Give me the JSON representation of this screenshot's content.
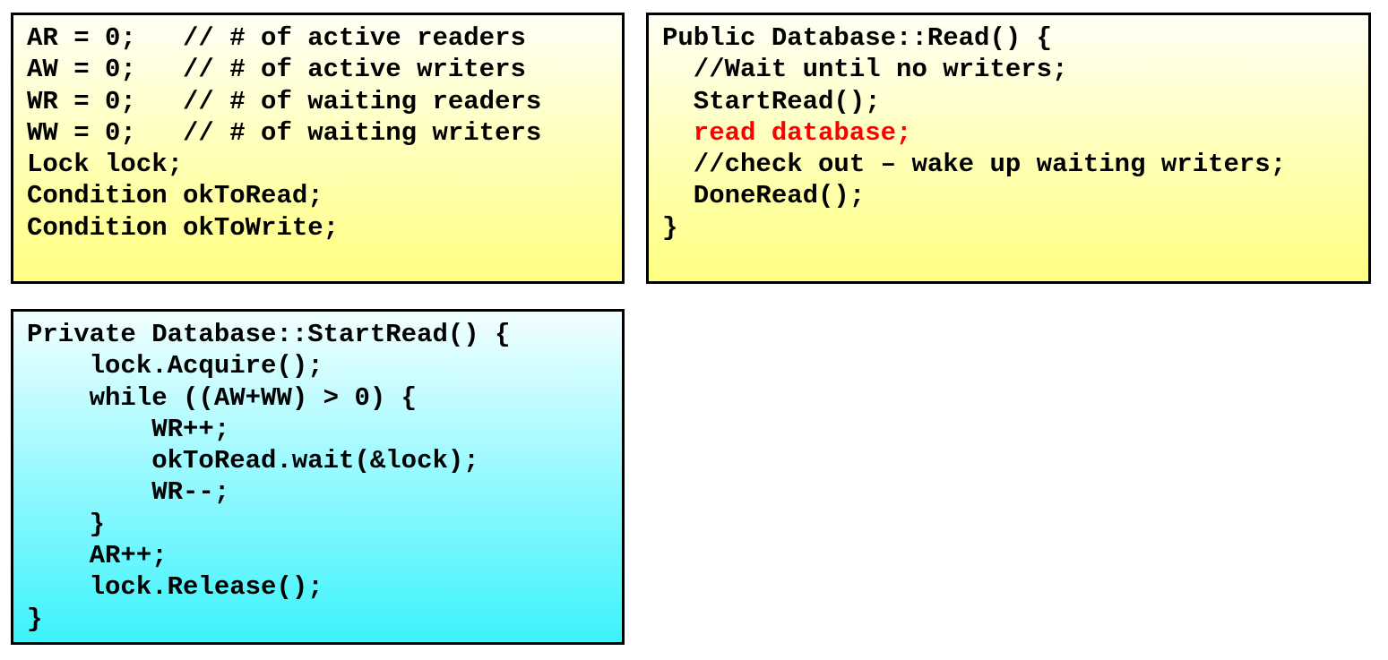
{
  "shared_state": {
    "lines": [
      "AR = 0;   // # of active readers",
      "AW = 0;   // # of active writers",
      "WR = 0;   // # of waiting readers",
      "WW = 0;   // # of waiting writers",
      "Lock lock;",
      "Condition okToRead;",
      "Condition okToWrite;"
    ]
  },
  "read_function": {
    "lines": [
      "Public Database::Read() {",
      "  //Wait until no writers;",
      "  StartRead();",
      "  read database;",
      "  //check out – wake up waiting writers;",
      "  DoneRead();",
      "}"
    ],
    "highlight_color": "#ff0000"
  },
  "start_read_function": {
    "lines": [
      "Private Database::StartRead() {",
      "    lock.Acquire();",
      "    while ((AW+WW) > 0) {",
      "        WR++;",
      "        okToRead.wait(&lock);",
      "        WR--;",
      "    }",
      "    AR++;",
      "    lock.Release();",
      "}"
    ]
  },
  "colors": {
    "yellow_box": "#ffffb4",
    "cyan_box": "#3cf3fb",
    "border": "#000000"
  }
}
